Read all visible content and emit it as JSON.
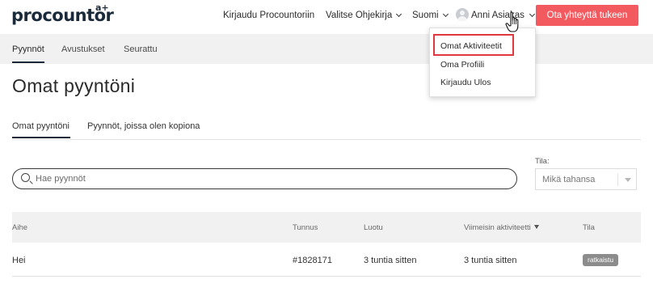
{
  "header": {
    "logo": "procountor",
    "logo_sup": "a+",
    "nav": {
      "login_procountor": "Kirjaudu Procountoriin",
      "choose_guide": "Valitse Ohjekirja",
      "language": "Suomi",
      "user_name": "Anni Asiakas"
    },
    "cta_label": "Ota yhteyttä tukeen"
  },
  "subnav": {
    "items": [
      "Pyynnöt",
      "Avustukset",
      "Seurattu"
    ],
    "active": "Pyynnöt"
  },
  "user_menu": {
    "items": [
      "Omat Aktiviteetit",
      "Oma Profiili",
      "Kirjaudu Ulos"
    ],
    "highlighted": "Omat Aktiviteetit"
  },
  "page": {
    "title": "Omat pyyntöni",
    "tabs": [
      "Omat pyyntöni",
      "Pyynnöt, joissa olen kopiona"
    ],
    "active_tab": "Omat pyyntöni"
  },
  "search": {
    "placeholder": "Hae pyynnöt",
    "value": ""
  },
  "status_filter": {
    "label": "Tila:",
    "selected": "Mikä tahansa"
  },
  "table": {
    "columns": [
      "Aihe",
      "Tunnus",
      "Luotu",
      "Viimeisin aktiviteetti",
      "Tila"
    ],
    "sorted_column": "Viimeisin aktiviteetti",
    "rows": [
      {
        "subject": "Hei",
        "id": "#1828171",
        "created": "3 tuntia sitten",
        "last_activity": "3 tuntia sitten",
        "status": "ratkaistu"
      }
    ]
  },
  "colors": {
    "accent_cta": "#f25a5f",
    "highlight_border": "#e0383e",
    "navy": "#1b2a3a",
    "status_badge": "#8c8c8c"
  }
}
